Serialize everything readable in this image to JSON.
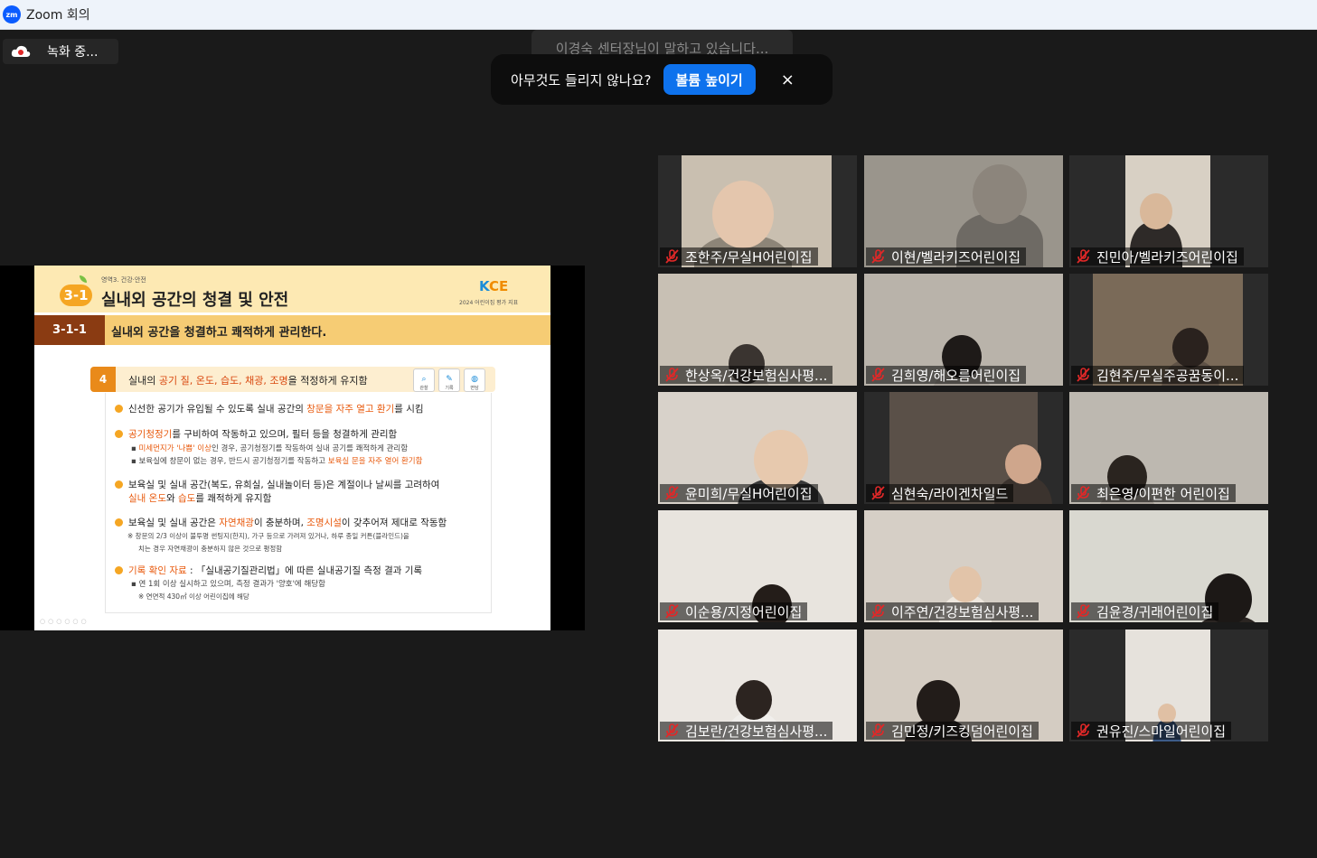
{
  "window": {
    "app_logo": "zm",
    "title": "Zoom 회의"
  },
  "recording": {
    "label": "녹화 중..."
  },
  "speaker_banner": {
    "text": "이경숙 센터장님이 말하고 있습니다..."
  },
  "audio_toast": {
    "message": "아무것도 들리지 않나요?",
    "button_label": "볼륨 높이기",
    "close_glyph": "×"
  },
  "slide": {
    "domain_label": "영역3. 건강·안전",
    "section_number": "3-1",
    "section_title": "실내외 공간의 청결 및 안전",
    "logo_text_k": "K",
    "logo_text": "CE",
    "logo_subtitle": "2024 어린이집 평가 지표",
    "sub_number": "3-1-1",
    "sub_title": "실내외 공간을 청결하고 쾌적하게 관리한다.",
    "item_number": "4",
    "item_text_pre": "실내의 ",
    "item_text_highlight": "공기 질, 온도, 습도, 채광, 조명",
    "item_text_post": "을 적정하게 유지함",
    "methods": [
      {
        "icon": "magnifier-icon",
        "label": "관찰"
      },
      {
        "icon": "pencil-icon",
        "label": "기록"
      },
      {
        "icon": "speech-bubble-icon",
        "label": "면담"
      }
    ],
    "bullets": {
      "b1_pre": "신선한 공기가 유입될 수 있도록 실내 공간의 ",
      "b1_hl": "창문을 자주 열고 환기",
      "b1_post": "를 시킴",
      "b2_hl": "공기청정기",
      "b2_post": "를 구비하여 작동하고 있으며, 필터 등을 청결하게 관리함",
      "b2_s1": "미세먼지가 '나쁨' 이상",
      "b2_s1_post": "인 경우, 공기청정기를 작동하여 실내 공기를 쾌적하게 관리함",
      "b2_s2_pre": "보육실에 창문이 없는 경우, 반드시 공기청정기를 작동하고 ",
      "b2_s2_hl": "보육실 문을 자주 열어 환기함",
      "b3_line1": "보육실 및 실내 공간(복도, 유희실, 실내놀이터 등)은 계절이나 날씨를 고려하여",
      "b3_hl1": "실내 온도",
      "b3_mid": "와 ",
      "b3_hl2": "습도",
      "b3_post": "를 쾌적하게 유지함",
      "b4_pre": "보육실 및 실내 공간은 ",
      "b4_hl1": "자연채광",
      "b4_mid": "이 충분하며, ",
      "b4_hl2": "조명시설",
      "b4_post": "이 갖추어져 제대로 작동함",
      "b4_note1": "※ 창문의 2/3 이상이 불투명 썬팅지(한지), 가구 등으로 가려져 있거나, 하루 종일 커튼(블라인드)을",
      "b4_note2": "치는 경우 자연채광이 충분하지 않은 것으로 평정함",
      "b5_hl": "기록 확인 자료",
      "b5_post": " : 「실내공기질관리법」에 따른 실내공기질 측정 결과 기록",
      "b5_s1": "연 1회 이상 실시하고 있으며, 측정 결과가 '양호'에 해당함",
      "b5_note": "※ 연면적 430㎡ 이상 어린이집에 해당"
    },
    "footer_dots": "○○○○○○"
  },
  "participants": [
    {
      "name": "조한주/무실H어린이집",
      "bg": "#c9bfb0",
      "muted": true
    },
    {
      "name": "이현/벨라키즈어린이집",
      "bg": "#9a958c",
      "muted": true
    },
    {
      "name": "진민아/벨라키즈어린이집",
      "bg": "#d8d0c4",
      "muted": true
    },
    {
      "name": "한상옥/건강보험심사평...",
      "bg": "#c8c0b4",
      "muted": true
    },
    {
      "name": "김희영/해오름어린이집",
      "bg": "#b9b3aa",
      "muted": true
    },
    {
      "name": "김현주/무실주공꿈동이...",
      "bg": "#7a6a58",
      "muted": true
    },
    {
      "name": "윤미희/무실H어린이집",
      "bg": "#d8d2ca",
      "muted": true
    },
    {
      "name": "심현숙/라이겐차일드",
      "bg": "#5a5048",
      "muted": true
    },
    {
      "name": "최은영/이편한 어린이집",
      "bg": "#bdb8b0",
      "muted": true
    },
    {
      "name": "이순용/지정어린이집",
      "bg": "#e8e4de",
      "muted": true
    },
    {
      "name": "이주연/건강보험심사평...",
      "bg": "#d6cfc6",
      "muted": true
    },
    {
      "name": "김윤경/귀래어린이집",
      "bg": "#d9d8d0",
      "muted": true
    },
    {
      "name": "김보란/건강보험심사평...",
      "bg": "#ebe7e2",
      "muted": true
    },
    {
      "name": "김민정/키즈킹덤어린이집",
      "bg": "#d4ccc2",
      "muted": true
    },
    {
      "name": "권유진/스마일어린이집",
      "bg": "#e6e2dc",
      "muted": true
    }
  ],
  "colors": {
    "zoom_blue": "#0e72ed",
    "muted_red": "#e02828",
    "slide_orange": "#f5a623"
  }
}
